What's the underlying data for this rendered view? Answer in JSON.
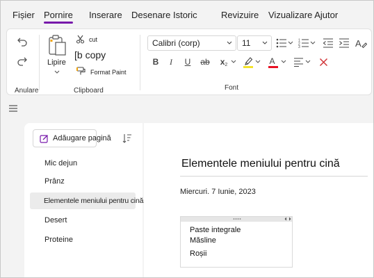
{
  "menu": {
    "tabs": [
      {
        "label": "Fișier"
      },
      {
        "label": "Pornire"
      },
      {
        "label": "Inserare"
      },
      {
        "label": "Desenare Istoric"
      },
      {
        "label": "Revizuire"
      },
      {
        "label": "Vizualizare Ajutor"
      }
    ]
  },
  "ribbon": {
    "undo_group_label": "Anulare",
    "clipboard": {
      "group_label": "Clipboard",
      "paste_label": "Lipire",
      "cut_label": "cut",
      "copy_label": "[b copy",
      "format_paint_label": "Format Paint"
    },
    "font": {
      "group_label": "Font",
      "font_name": "Calibri (corp)",
      "font_size": "11"
    }
  },
  "pages_pane": {
    "add_page_label": "Adăugare pagină",
    "pages": [
      {
        "label": "Mic dejun"
      },
      {
        "label": "Prânz"
      },
      {
        "label": "Elementele meniului pentru cină"
      },
      {
        "label": "Desert"
      },
      {
        "label": "Proteine"
      }
    ],
    "selected_index": 2
  },
  "note": {
    "title": "Elementele meniului pentru cină",
    "date": "Miercuri. 7 Iunie, 2023",
    "outline_lines": [
      "Paste integrale",
      "Măsline",
      "Roșii"
    ]
  },
  "colors": {
    "accent": "#7719aa",
    "highlight": "#f3e32b",
    "font_color": "#e81123",
    "clear_format": "#d13438"
  }
}
